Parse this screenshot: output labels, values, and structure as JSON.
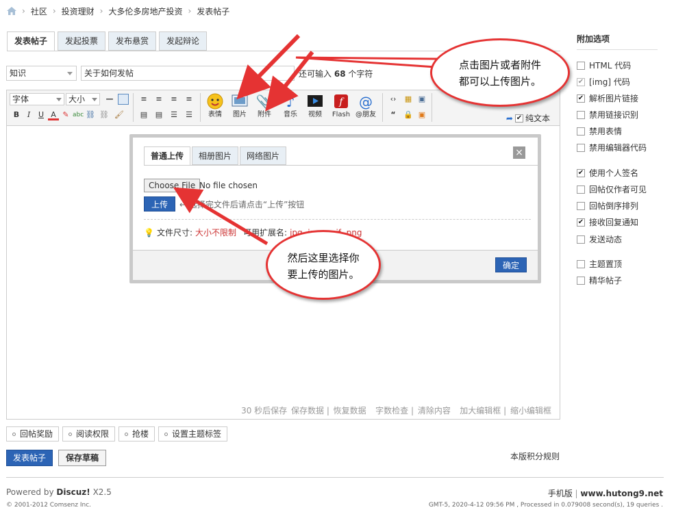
{
  "breadcrumb": {
    "items": [
      "社区",
      "投资理财",
      "大多伦多房地产投资",
      "发表帖子"
    ]
  },
  "tabs": [
    "发表帖子",
    "发起投票",
    "发布悬赏",
    "发起辩论"
  ],
  "subject": {
    "category": "知识",
    "title": "关于如何发帖",
    "remain_prefix": "还可输入",
    "remain_count": "68",
    "remain_suffix": "个字符"
  },
  "toolbar": {
    "font": "字体",
    "size": "大小",
    "big_buttons": [
      "表情",
      "图片",
      "附件",
      "音乐",
      "视频",
      "Flash",
      "@朋友"
    ],
    "plain_text": "纯文本"
  },
  "status_bar": {
    "autosave": "30 秒后保存",
    "save": "保存数据",
    "restore": "恢复数据",
    "check": "字数检查",
    "clear": "清除内容",
    "enlarge": "加大编辑框",
    "shrink": "缩小编辑框"
  },
  "options": [
    "回帖奖励",
    "阅读权限",
    "抢楼",
    "设置主题标签"
  ],
  "buttons": {
    "post": "发表帖子",
    "draft": "保存草稿",
    "rules": "本版积分规则"
  },
  "sidebar": {
    "title": "附加选项",
    "items": [
      {
        "label": "HTML 代码",
        "checked": false,
        "disabled": false
      },
      {
        "label": "[img] 代码",
        "checked": true,
        "disabled": true
      },
      {
        "label": "解析图片链接",
        "checked": true,
        "disabled": false
      },
      {
        "label": "禁用链接识别",
        "checked": false,
        "disabled": false
      },
      {
        "label": "禁用表情",
        "checked": false,
        "disabled": false
      },
      {
        "label": "禁用编辑器代码",
        "checked": false,
        "disabled": false
      },
      {
        "label": "使用个人签名",
        "checked": true,
        "disabled": false
      },
      {
        "label": "回帖仅作者可见",
        "checked": false,
        "disabled": false
      },
      {
        "label": "回帖倒序排列",
        "checked": false,
        "disabled": false
      },
      {
        "label": "接收回复通知",
        "checked": true,
        "disabled": false
      },
      {
        "label": "发送动态",
        "checked": false,
        "disabled": false
      },
      {
        "label": "主题置顶",
        "checked": false,
        "disabled": false
      },
      {
        "label": "精华帖子",
        "checked": false,
        "disabled": false
      }
    ]
  },
  "dialog": {
    "tabs": [
      "普通上传",
      "相册图片",
      "网络图片"
    ],
    "close": "×",
    "choose_file": "Choose File",
    "no_file": "No file chosen",
    "upload": "上传",
    "hint": "← 选择完文件后请点击“上传”按钮",
    "file_size_label": "文件尺寸:",
    "file_size_value": "大小不限制",
    "ext_label": "可用扩展名:",
    "ext_value": "jpg, jpeg, gif, png",
    "ok": "确定"
  },
  "callouts": {
    "top": [
      "点击图片或者附件",
      "都可以上传图片。"
    ],
    "bottom": [
      "然后这里选择你",
      "要上传的图片。"
    ]
  },
  "footer": {
    "powered": "Powered by",
    "brand": "Discuz!",
    "version": "X2.5",
    "copyright": "© 2001-2012 Comsenz Inc.",
    "mobile": "手机版",
    "site": "www.hutong9.net",
    "gmt": "GMT-5, 2020-4-12 09:56 PM , Processed in 0.079008 second(s), 19 queries ."
  },
  "colors": {
    "accent": "#2c64b5",
    "callout": "#e53333"
  }
}
